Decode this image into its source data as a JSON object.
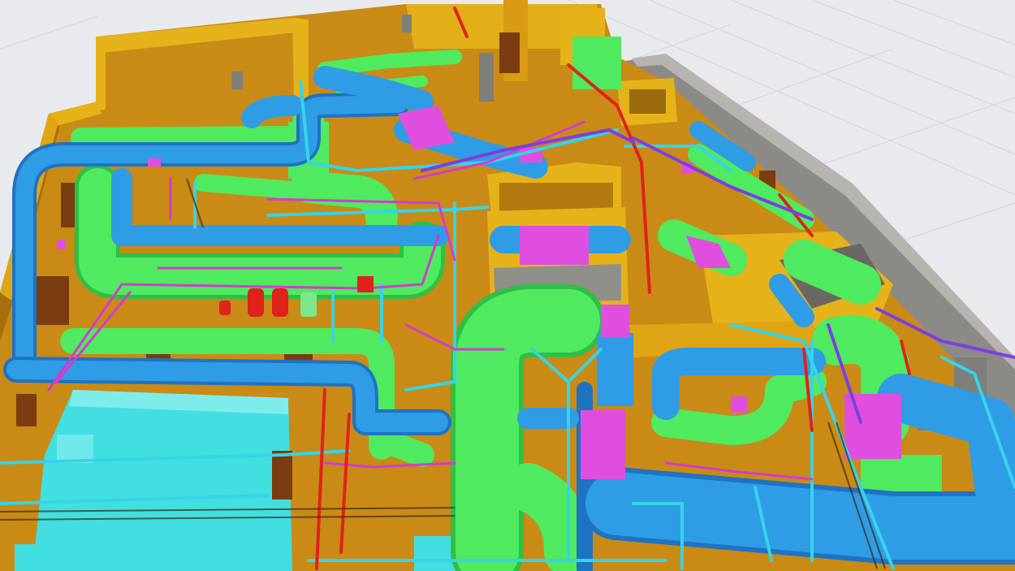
{
  "scene": {
    "kind": "3d-bim-mep-model",
    "view": "isometric-perspective",
    "contains": [
      "hvac-ducts",
      "pipes",
      "cable-trays",
      "equipment",
      "walls",
      "floor-slab"
    ]
  },
  "colors": {
    "background": "#e8eaed",
    "grid_line": "#d3d6db",
    "floor": "#c98a16",
    "floor_dark": "#a86f0e",
    "wall_outer": "#8c8a87",
    "wall_top": "#b7b3ae",
    "wall_yellow": "#e6b21a",
    "supply_duct": "#2f9ce6",
    "supply_duct_dark": "#1e73c2",
    "return_duct": "#4fea5f",
    "return_duct_dark": "#2fbf45",
    "fitting": "#e04ee0",
    "pipe_cyan": "#35d4e8",
    "pipe_magenta": "#d23ccf",
    "pipe_red": "#e0221c",
    "pipe_purple": "#7b3fe0",
    "equipment_cyan": "#42dfe0",
    "equipment_brown": "#7a3c10",
    "equipment_gray": "#7d7f7a"
  }
}
